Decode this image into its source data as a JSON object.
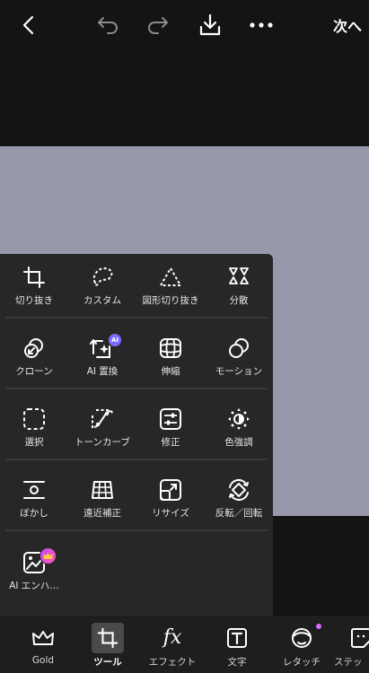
{
  "header": {
    "next_label": "次へ",
    "icons": {
      "back": "chevron-left",
      "undo": "undo-arrow",
      "redo": "redo-arrow",
      "download": "download-tray",
      "more": "ellipsis"
    }
  },
  "colors": {
    "panel_bg": "#272727",
    "canvas_image": "#9898ab",
    "app_bg": "#141414",
    "accent_ai": "#7b6cff"
  },
  "tools": {
    "rows": [
      [
        {
          "label": "切り抜き",
          "icon": "crop"
        },
        {
          "label": "カスタム",
          "icon": "lasso"
        },
        {
          "label": "図形切り抜き",
          "icon": "shape-crop"
        },
        {
          "label": "分散",
          "icon": "disperse"
        }
      ],
      [
        {
          "label": "クローン",
          "icon": "clone"
        },
        {
          "label": "AI 置換",
          "icon": "ai-replace",
          "badge": "AI"
        },
        {
          "label": "伸縮",
          "icon": "stretch"
        },
        {
          "label": "モーション",
          "icon": "motion"
        }
      ],
      [
        {
          "label": "選択",
          "icon": "select"
        },
        {
          "label": "トーンカーブ",
          "icon": "curves"
        },
        {
          "label": "修正",
          "icon": "adjust"
        },
        {
          "label": "色強調",
          "icon": "color-splash"
        }
      ],
      [
        {
          "label": "ぼかし",
          "icon": "blur"
        },
        {
          "label": "遠近補正",
          "icon": "perspective"
        },
        {
          "label": "リサイズ",
          "icon": "resize"
        },
        {
          "label": "反転／回転",
          "icon": "flip-rotate"
        }
      ],
      [
        {
          "label": "AI エンハ…",
          "icon": "ai-enhance",
          "badge": "crown"
        }
      ]
    ]
  },
  "bottom_nav": {
    "items": [
      {
        "label": "Gold",
        "icon": "crown"
      },
      {
        "label": "ツール",
        "icon": "crop",
        "active": true
      },
      {
        "label": "エフェクト",
        "icon": "fx"
      },
      {
        "label": "文字",
        "icon": "text"
      },
      {
        "label": "レタッチ",
        "icon": "retouch-face"
      },
      {
        "label": "ステッ",
        "icon": "sticker"
      }
    ]
  }
}
